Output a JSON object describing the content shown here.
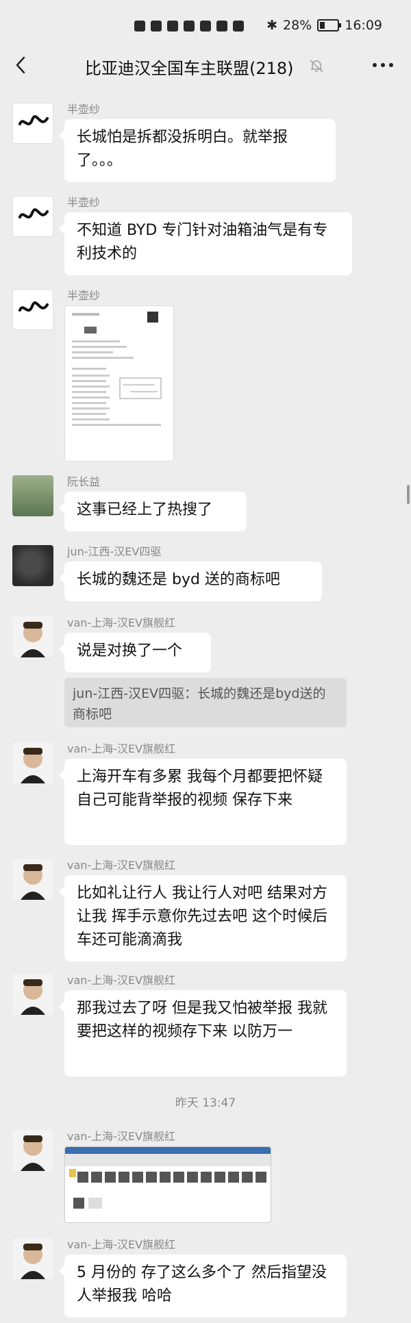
{
  "status": {
    "battery_percent": "28%",
    "battery_level": 0.28,
    "time": "16:09"
  },
  "nav": {
    "title": "比亚迪汉全国车主联盟(218)"
  },
  "messages": [
    {
      "sender": "半壶纱",
      "text": "长城怕是拆都没拆明白。就举报了。。。"
    },
    {
      "sender": "半壶纱",
      "text": "不知道 BYD 专门针对油箱油气是有专利技术的"
    },
    {
      "sender": "半壶纱"
    },
    {
      "sender": "阮长益",
      "text": "这事已经上了热搜了"
    },
    {
      "sender": "jun-江西-汉EV四驱",
      "text": "长城的魏还是 byd 送的商标吧"
    },
    {
      "sender": "van-上海-汉EV旗舰红",
      "text": "说是对换了一个",
      "quote": "jun-江西-汉EV四驱：长城的魏还是byd送的商标吧"
    },
    {
      "sender": "van-上海-汉EV旗舰红",
      "text": "上海开车有多累 我每个月都要把怀疑自己可能背举报的视频 保存下来"
    },
    {
      "sender": "van-上海-汉EV旗舰红",
      "text": "比如礼让行人 我让行人对吧  结果对方让我 挥手示意你先过去吧 这个时候后车还可能滴滴我"
    },
    {
      "sender": "van-上海-汉EV旗舰红",
      "text": "那我过去了呀  但是我又怕被举报 我就要把这样的视频存下来 以防万一"
    },
    {
      "sender": "van-上海-汉EV旗舰红"
    },
    {
      "sender": "van-上海-汉EV旗舰红",
      "text": "5 月份的 存了这么多个了  然后指望没人举报我 哈哈"
    }
  ],
  "timestamp": "昨天 13:47"
}
